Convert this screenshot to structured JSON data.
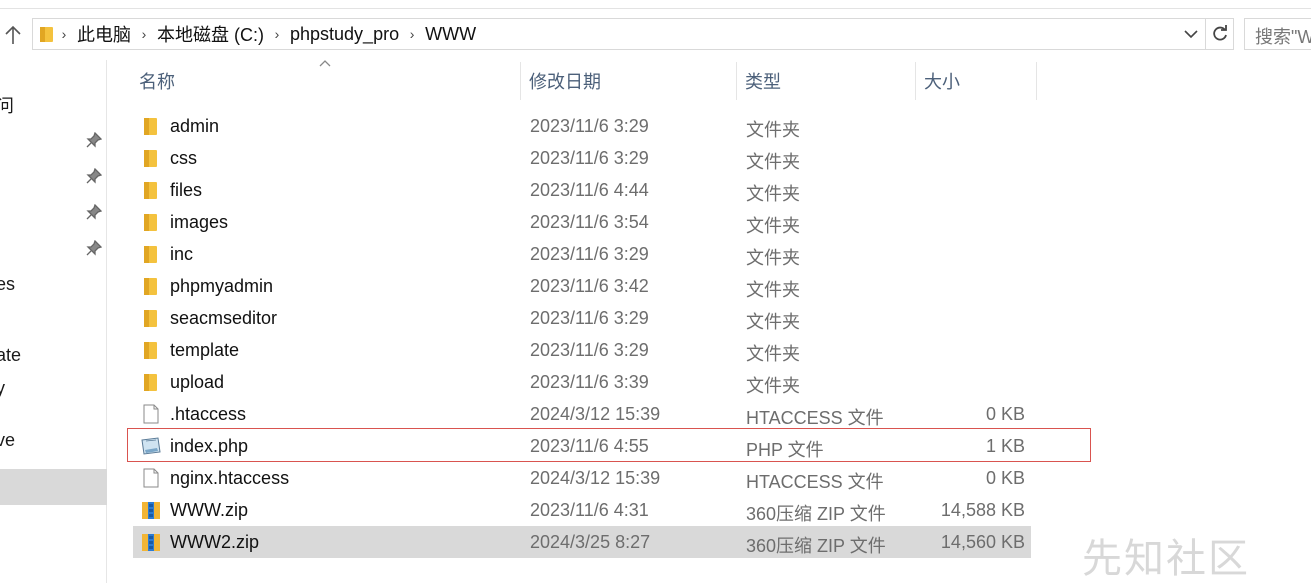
{
  "addressbar": {
    "crumbs": [
      "此电脑",
      "本地磁盘 (C:)",
      "phpstudy_pro",
      "WWW"
    ],
    "search_placeholder": "搜索\"WWW\""
  },
  "nav": {
    "labels": [
      "问",
      "es",
      "ate",
      "y",
      "ve"
    ]
  },
  "columns": {
    "name": "名称",
    "date": "修改日期",
    "type": "类型",
    "size": "大小"
  },
  "files": [
    {
      "name": "admin",
      "date": "2023/11/6 3:29",
      "type": "文件夹",
      "size": "",
      "icon": "folder-icon"
    },
    {
      "name": "css",
      "date": "2023/11/6 3:29",
      "type": "文件夹",
      "size": "",
      "icon": "folder-icon"
    },
    {
      "name": "files",
      "date": "2023/11/6 4:44",
      "type": "文件夹",
      "size": "",
      "icon": "folder-icon"
    },
    {
      "name": "images",
      "date": "2023/11/6 3:54",
      "type": "文件夹",
      "size": "",
      "icon": "folder-icon"
    },
    {
      "name": "inc",
      "date": "2023/11/6 3:29",
      "type": "文件夹",
      "size": "",
      "icon": "folder-icon"
    },
    {
      "name": "phpmyadmin",
      "date": "2023/11/6 3:42",
      "type": "文件夹",
      "size": "",
      "icon": "folder-icon"
    },
    {
      "name": "seacmseditor",
      "date": "2023/11/6 3:29",
      "type": "文件夹",
      "size": "",
      "icon": "folder-icon"
    },
    {
      "name": "template",
      "date": "2023/11/6 3:29",
      "type": "文件夹",
      "size": "",
      "icon": "folder-icon"
    },
    {
      "name": "upload",
      "date": "2023/11/6 3:39",
      "type": "文件夹",
      "size": "",
      "icon": "folder-icon"
    },
    {
      "name": ".htaccess",
      "date": "2024/3/12 15:39",
      "type": "HTACCESS 文件",
      "size": "0 KB",
      "icon": "file-icon"
    },
    {
      "name": "index.php",
      "date": "2023/11/6 4:55",
      "type": "PHP 文件",
      "size": "1 KB",
      "icon": "php-file-icon"
    },
    {
      "name": "nginx.htaccess",
      "date": "2024/3/12 15:39",
      "type": "HTACCESS 文件",
      "size": "0 KB",
      "icon": "file-icon"
    },
    {
      "name": "WWW.zip",
      "date": "2023/11/6 4:31",
      "type": "360压缩 ZIP 文件",
      "size": "14,588 KB",
      "icon": "zip-archive-icon"
    },
    {
      "name": "WWW2.zip",
      "date": "2024/3/25 8:27",
      "type": "360压缩 ZIP 文件",
      "size": "14,560 KB",
      "icon": "zip-archive-icon"
    }
  ],
  "watermark": "先知社区",
  "colors": {
    "highlight_border": "#d9534f",
    "selection_bg": "#d9d9d9",
    "folder_yellow": "#f4c23e",
    "header_text": "#4c607a"
  }
}
